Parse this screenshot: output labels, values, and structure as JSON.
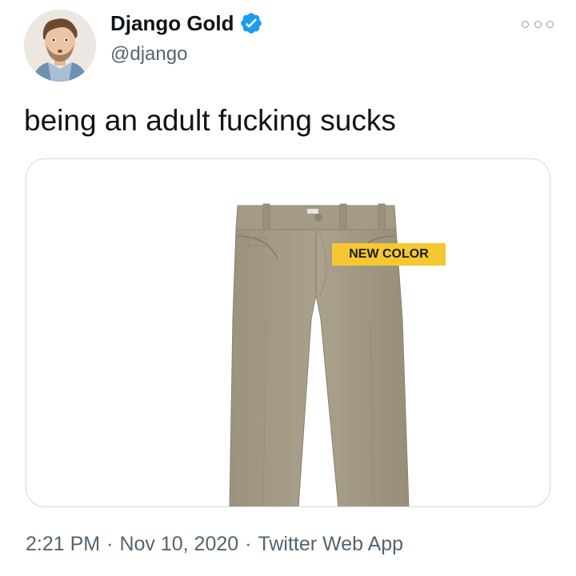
{
  "author": {
    "display_name": "Django Gold",
    "handle": "@django",
    "verified": true,
    "avatar_icon": "profile-photo"
  },
  "menu": {
    "icon": "more-options-icon"
  },
  "tweet": {
    "text": "being an adult fucking sucks",
    "media": {
      "badge_label": "NEW COLOR",
      "badge_color": "#f5c832",
      "pants_color": "#a69d88"
    }
  },
  "meta": {
    "time": "2:21 PM",
    "date": "Nov 10, 2020",
    "source": "Twitter Web App",
    "separator": "·"
  },
  "colors": {
    "text_primary": "#0f1419",
    "text_secondary": "#536471",
    "verified_blue": "#1d9bf0",
    "border": "#cfd9de"
  }
}
